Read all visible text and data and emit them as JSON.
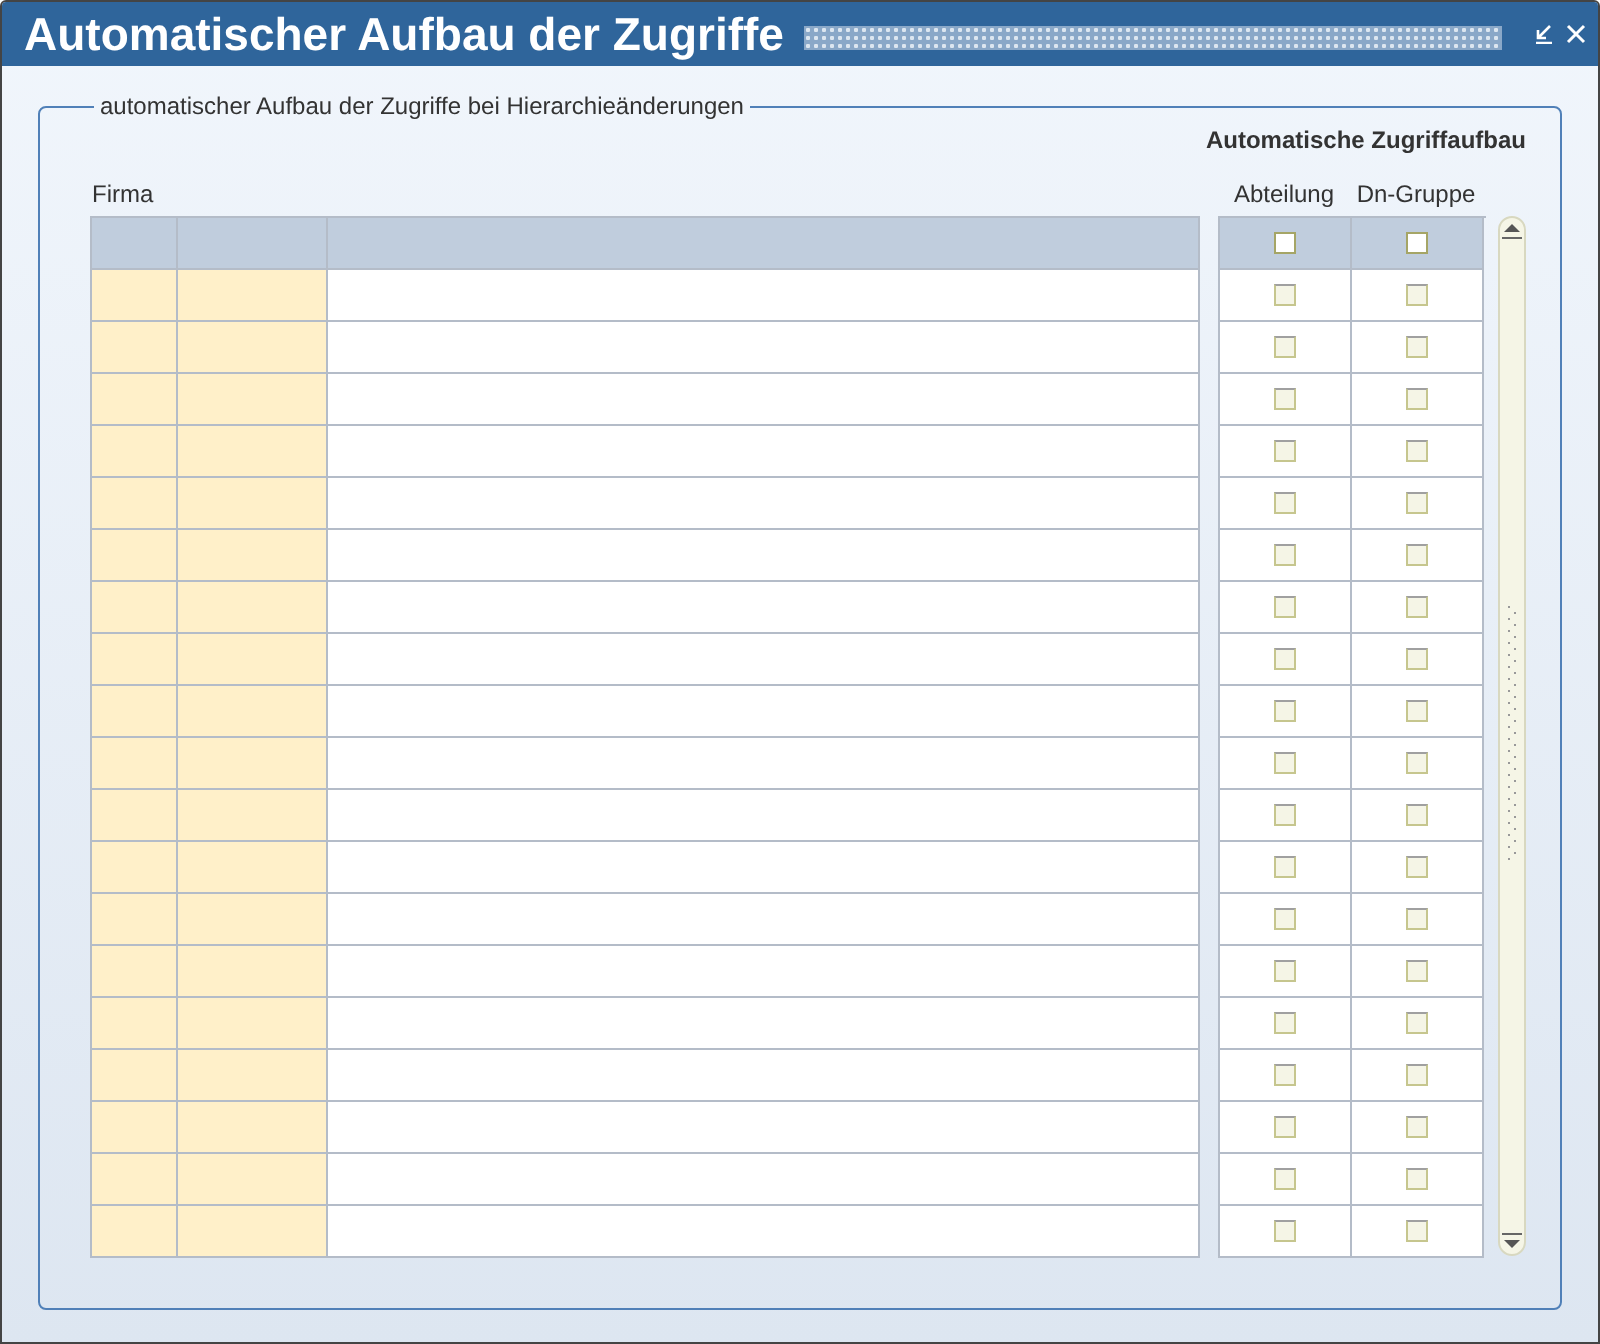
{
  "window": {
    "title": "Automatischer Aufbau der Zugriffe"
  },
  "group": {
    "legend": "automatischer Aufbau der Zugriffe bei Hierarchieänderungen",
    "heading": "Automatische Zugriffaufbau",
    "firma_label": "Firma",
    "columns": [
      {
        "label": "Abteilung",
        "header_checked": false
      },
      {
        "label": "Dn-Gruppe",
        "header_checked": false
      }
    ],
    "rows": [
      {
        "disabled": true,
        "checks": [
          false,
          false
        ]
      },
      {
        "disabled": true,
        "checks": [
          false,
          false
        ]
      },
      {
        "disabled": true,
        "checks": [
          false,
          false
        ]
      },
      {
        "disabled": true,
        "checks": [
          false,
          false
        ]
      },
      {
        "disabled": true,
        "checks": [
          false,
          false
        ]
      },
      {
        "disabled": true,
        "checks": [
          false,
          false
        ]
      },
      {
        "disabled": true,
        "checks": [
          false,
          false
        ]
      },
      {
        "disabled": true,
        "checks": [
          false,
          false
        ]
      },
      {
        "disabled": true,
        "checks": [
          false,
          false
        ]
      },
      {
        "disabled": true,
        "checks": [
          false,
          false
        ]
      },
      {
        "disabled": true,
        "checks": [
          false,
          false
        ]
      },
      {
        "disabled": true,
        "checks": [
          false,
          false
        ]
      },
      {
        "disabled": true,
        "checks": [
          false,
          false
        ]
      },
      {
        "disabled": true,
        "checks": [
          false,
          false
        ]
      },
      {
        "disabled": true,
        "checks": [
          false,
          false
        ]
      },
      {
        "disabled": true,
        "checks": [
          false,
          false
        ]
      },
      {
        "disabled": true,
        "checks": [
          false,
          false
        ]
      },
      {
        "disabled": true,
        "checks": [
          false,
          false
        ]
      },
      {
        "disabled": true,
        "checks": [
          false,
          false
        ]
      }
    ]
  }
}
